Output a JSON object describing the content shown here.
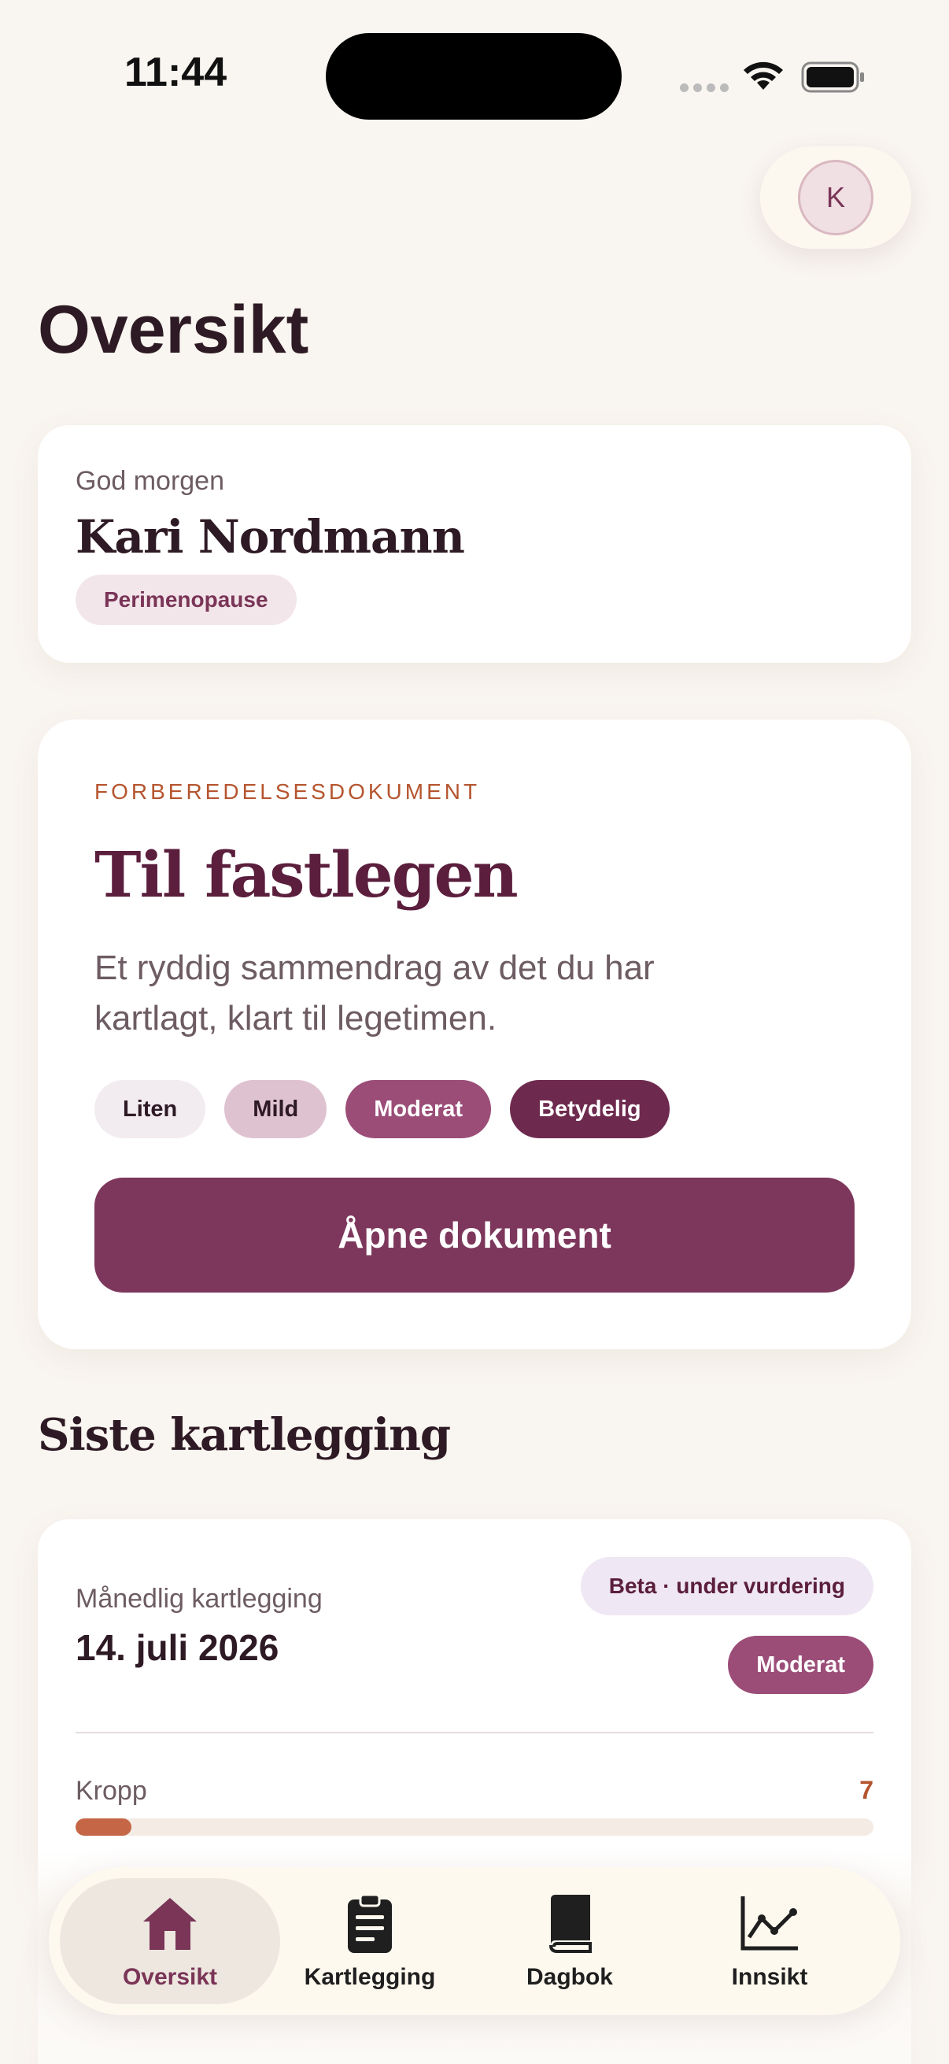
{
  "status_bar": {
    "time": "11:44"
  },
  "profile": {
    "initial": "K"
  },
  "page": {
    "title": "Oversikt"
  },
  "greeting": {
    "label": "God morgen",
    "name": "Kari Nordmann",
    "phase": "Perimenopause"
  },
  "document_card": {
    "kicker": "FORBEREDELSESDOKUMENT",
    "title": "Til fastlegen",
    "description": "Et ryddig sammendrag av det du har kartlagt, klart til legetimen.",
    "severity_levels": [
      "Liten",
      "Mild",
      "Moderat",
      "Betydelig"
    ],
    "button_label": "Åpne dokument"
  },
  "latest": {
    "section_title": "Siste kartlegging",
    "type": "Månedlig kartlegging",
    "date": "14. juli 2026",
    "beta_badge": "Beta · under vurdering",
    "severity_badge": "Moderat",
    "metrics": [
      {
        "label": "Kropp",
        "value": "7",
        "fill": 0.07
      }
    ]
  },
  "tabs": [
    {
      "label": "Oversikt",
      "icon": "home-icon",
      "active": true
    },
    {
      "label": "Kartlegging",
      "icon": "clipboard-icon",
      "active": false
    },
    {
      "label": "Dagbok",
      "icon": "book-icon",
      "active": false
    },
    {
      "label": "Innsikt",
      "icon": "chart-icon",
      "active": false
    }
  ],
  "colors": {
    "background": "#f9f5f0",
    "accent": "#7d375c",
    "kicker": "#b5552f",
    "bar_fill": "#c56646"
  }
}
